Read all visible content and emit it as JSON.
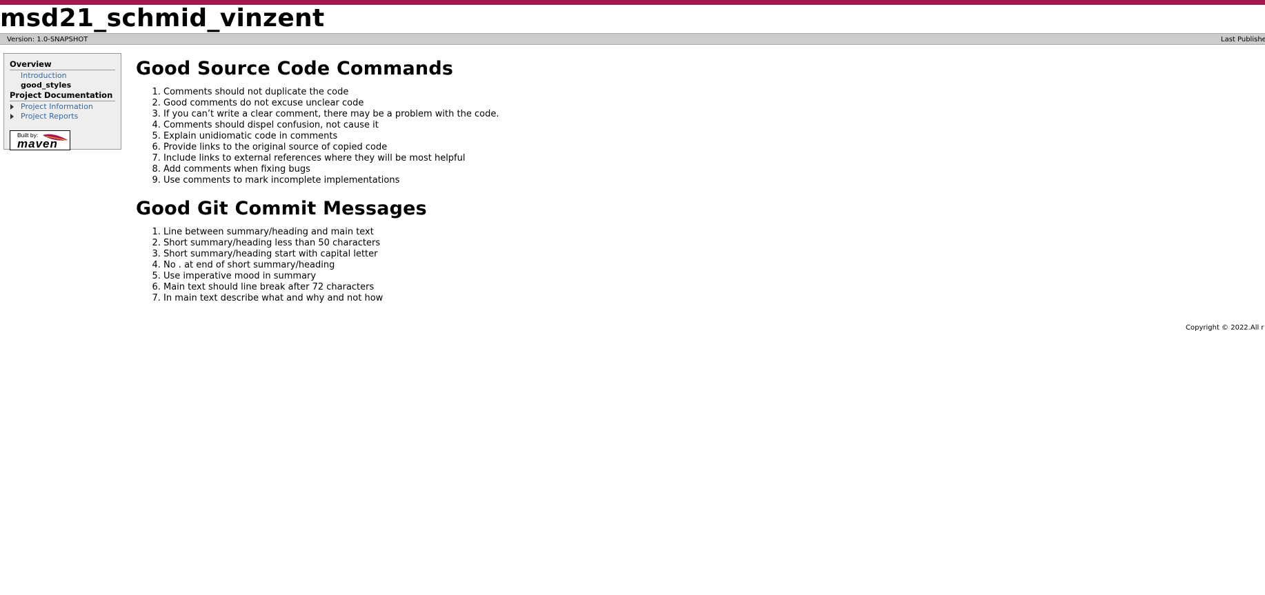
{
  "banner": {
    "title": "msd21_schmid_vinzent"
  },
  "breadcrumbs": {
    "version": "Version: 1.0-SNAPSHOT",
    "published": "Last Publishe"
  },
  "nav": {
    "overview_header": "Overview",
    "items": [
      {
        "label": "Introduction"
      },
      {
        "label": "good_styles"
      }
    ],
    "project_doc_header": "Project Documentation",
    "project_items": [
      {
        "label": "Project Information"
      },
      {
        "label": "Project Reports"
      }
    ],
    "maven_badge": {
      "built_by": "Built by:",
      "name": "maven"
    }
  },
  "main": {
    "section1": {
      "title": "Good Source Code Commands",
      "items": [
        "Comments should not duplicate the code",
        "Good comments do not excuse unclear code",
        "If you can’t write a clear comment, there may be a problem with the code.",
        "Comments should dispel confusion, not cause it",
        "Explain unidiomatic code in comments",
        "Provide links to the original source of copied code",
        "Include links to external references where they will be most helpful",
        "Add comments when fixing bugs",
        "Use comments to mark incomplete implementations"
      ]
    },
    "section2": {
      "title": "Good Git Commit Messages",
      "items": [
        "Line between summary/heading and main text",
        "Short summary/heading less than 50 characters",
        "Short summary/heading start with capital letter",
        "No . at end of short summary/heading",
        "Use imperative mood in summary",
        "Main text should line break after 72 characters",
        "In main text describe what and why and not how"
      ]
    }
  },
  "footer": {
    "copyright": "Copyright © 2022.All r"
  },
  "colors": {
    "topbar": "#a5164f",
    "link": "#3366aa",
    "breadcrumb_bg": "#cccccc"
  }
}
